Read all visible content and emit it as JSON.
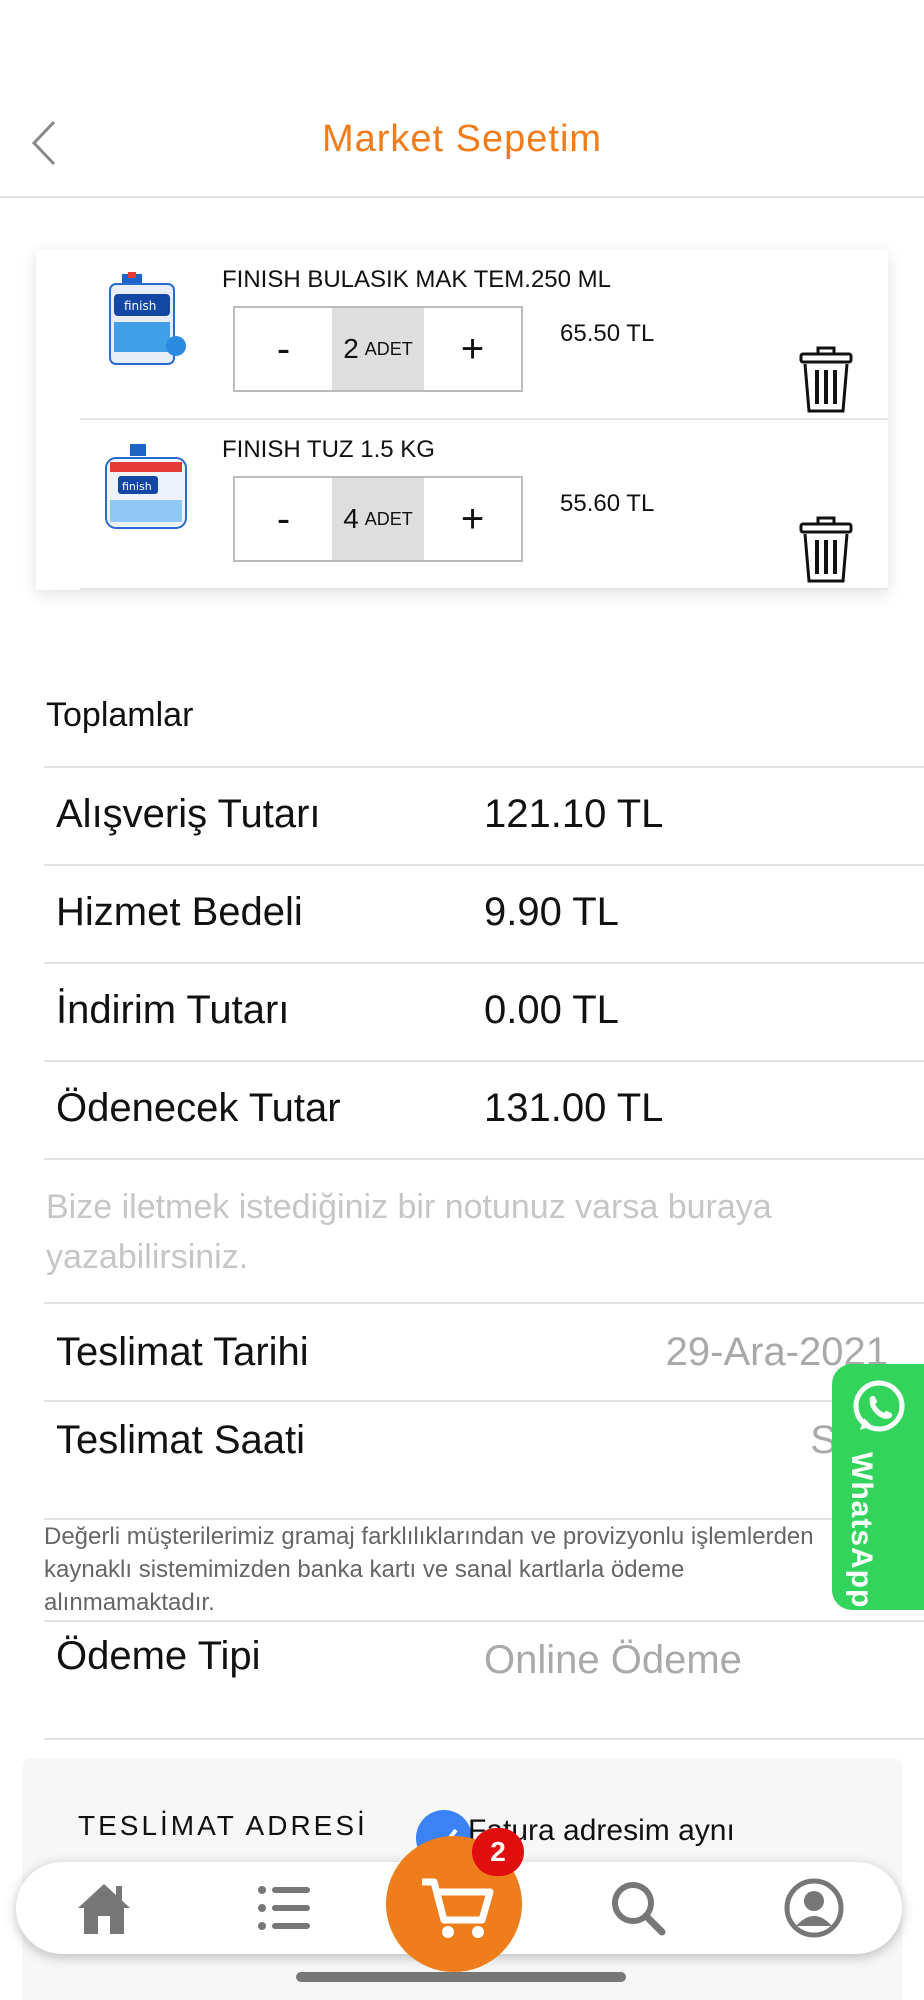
{
  "header": {
    "title": "Market Sepetim"
  },
  "cart": {
    "items": [
      {
        "name": "FINISH BULASIK MAK TEM.250 ML",
        "quantity": "2",
        "unit": "ADET",
        "price": "65.50 TL",
        "minus": "-",
        "plus": "+"
      },
      {
        "name": "FINISH TUZ 1.5 KG",
        "quantity": "4",
        "unit": "ADET",
        "price": "55.60 TL",
        "minus": "-",
        "plus": "+"
      }
    ]
  },
  "totals": {
    "title": "Toplamlar",
    "rows": [
      {
        "label": "Alışveriş Tutarı",
        "value": "121.10 TL"
      },
      {
        "label": "Hizmet Bedeli",
        "value": "9.90 TL"
      },
      {
        "label": "İndirim Tutarı",
        "value": "0.00 TL"
      },
      {
        "label": "Ödenecek Tutar",
        "value": "131.00 TL"
      }
    ]
  },
  "note": {
    "placeholder": "Bize iletmek istediğiniz bir notunuz varsa buraya yazabilirsiniz."
  },
  "delivery": {
    "date_label": "Teslimat Tarihi",
    "date_value": "29-Ara-2021",
    "time_label": "Teslimat Saati",
    "time_value": "Seçi"
  },
  "disclaimer": "Değerli müşterilerimiz gramaj farklılıklarından ve provizyonlu işlemlerden kaynaklı sistemimizden banka kartı ve sanal kartlarla ödeme alınmamaktadır.",
  "payment": {
    "label": "Ödeme Tipi",
    "value": "Online Ödeme"
  },
  "address": {
    "title": "TESLİMAT ADRESİ",
    "same_as_billing": "Fatura adresim aynı"
  },
  "whatsapp": {
    "label": "WhatsApp",
    "color": "#33d45b"
  },
  "tabbar": {
    "cart_badge": "2",
    "icons": [
      "home-icon",
      "list-icon",
      "cart-icon",
      "search-icon",
      "profile-icon"
    ]
  },
  "colors": {
    "accent": "#ef7d1c",
    "badge": "#e10e0e",
    "check": "#3b82f6"
  }
}
